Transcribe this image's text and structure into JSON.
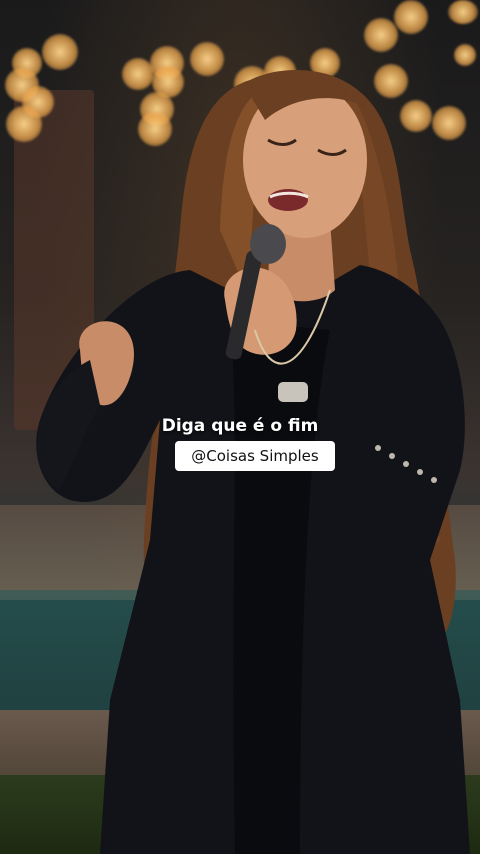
{
  "overlay": {
    "caption": "Diga que é o fim",
    "handle": "@Coisas Simples"
  },
  "colors": {
    "caption_text": "#ffffff",
    "handle_bg": "#ffffff",
    "handle_text": "#111111",
    "bokeh_light": "#f2b36a"
  }
}
